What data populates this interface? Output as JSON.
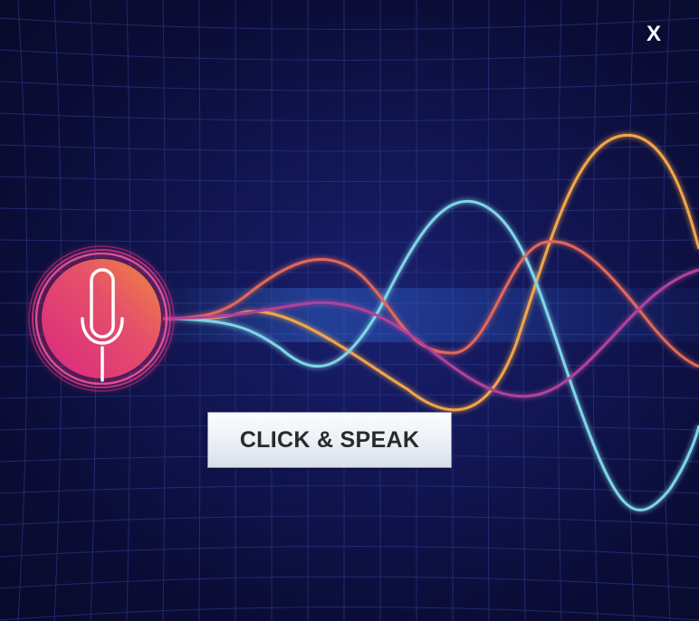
{
  "window": {
    "close_label": "X"
  },
  "main": {
    "speak_button_label": "CLICK & SPEAK"
  },
  "icons": {
    "microphone": "microphone-icon"
  },
  "colors": {
    "background": "#0c0f3a",
    "grid": "#2b3a8a",
    "mic_gradient_start": "#e03a8c",
    "mic_gradient_end": "#f08a3c",
    "wave_orange": "#f2a64a",
    "wave_cyan": "#7fd6e6",
    "wave_magenta": "#b0439a",
    "wave_coral": "#e2685a"
  }
}
